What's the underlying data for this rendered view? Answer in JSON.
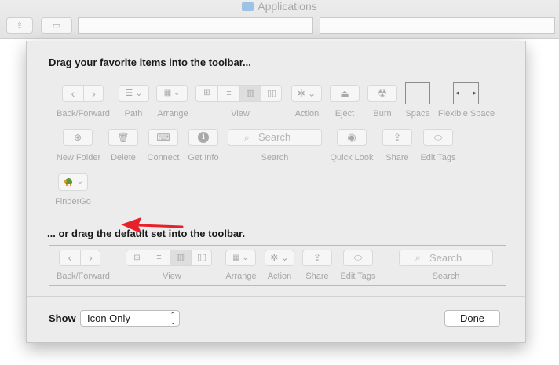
{
  "window": {
    "title": "Applications"
  },
  "sheet": {
    "heading_favorites": "Drag your favorite items into the toolbar...",
    "heading_default": "... or drag the default set into the toolbar.",
    "items": {
      "back_forward": "Back/Forward",
      "path": "Path",
      "arrange": "Arrange",
      "view": "View",
      "action": "Action",
      "eject": "Eject",
      "burn": "Burn",
      "space": "Space",
      "flexible_space": "Flexible Space",
      "new_folder": "New Folder",
      "delete": "Delete",
      "connect": "Connect",
      "get_info": "Get Info",
      "search": "Search",
      "search_placeholder": "Search",
      "quick_look": "Quick Look",
      "share": "Share",
      "edit_tags": "Edit Tags",
      "findergo": "FinderGo"
    },
    "default_set": {
      "back_forward": "Back/Forward",
      "view": "View",
      "arrange": "Arrange",
      "action": "Action",
      "share": "Share",
      "edit_tags": "Edit Tags",
      "search": "Search",
      "search_placeholder": "Search"
    },
    "footer": {
      "show_label": "Show",
      "show_value": "Icon Only",
      "done_label": "Done"
    }
  },
  "annotation": {
    "arrow_color": "#e8202a"
  }
}
